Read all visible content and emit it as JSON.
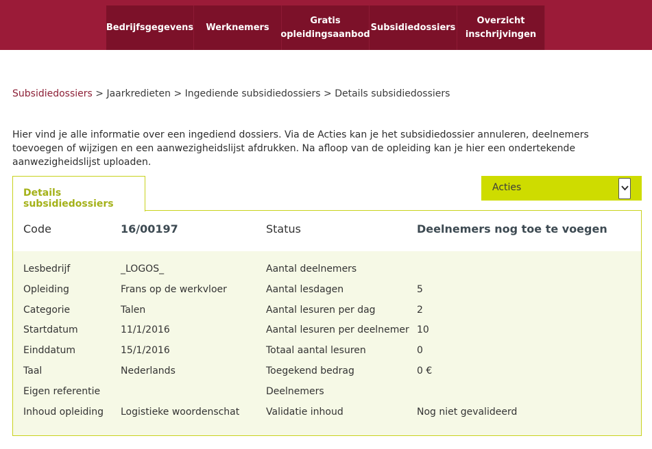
{
  "nav": {
    "items": [
      {
        "lines": [
          "Bedrijfsgegevens"
        ],
        "width": 128
      },
      {
        "lines": [
          "Werknemers"
        ],
        "width": 128
      },
      {
        "lines": [
          "Gratis",
          "opleidingsaanbod"
        ],
        "width": 128
      },
      {
        "lines": [
          "Subsidiedossiers"
        ],
        "width": 128
      },
      {
        "lines": [
          "Overzicht",
          "inschrijvingen"
        ],
        "width": 128
      }
    ]
  },
  "breadcrumb": {
    "link": "Subsidiedossiers",
    "rest": " > Jaarkredieten > Ingediende subsidiedossiers > Details subsidiedossiers"
  },
  "intro": "Hier vind je alle informatie over een ingediend dossiers. Via de Acties kan je het subsidiedossier annuleren, deelnemers toevoegen of wijzigen en een aanwezigheidslijst afdrukken. Na afloop van de opleiding kan je hier een ondertekende aanwezigheidslijst uploaden.",
  "tab": {
    "label": "Details subsidiedossiers"
  },
  "acties": {
    "label": "Acties",
    "color": "#cedc00"
  },
  "header": {
    "code_label": "Code",
    "code_value": "16/00197",
    "status_label": "Status",
    "status_value": "Deelnemers nog toe te voegen"
  },
  "rows": [
    {
      "l1": "Lesbedrijf",
      "v1": "_LOGOS_",
      "l2": "Aantal deelnemers",
      "v2": ""
    },
    {
      "l1": "Opleiding",
      "v1": "Frans op de werkvloer",
      "l2": "Aantal lesdagen",
      "v2": "5"
    },
    {
      "l1": "Categorie",
      "v1": "Talen",
      "l2": "Aantal lesuren per dag",
      "v2": "2"
    },
    {
      "l1": "Startdatum",
      "v1": "11/1/2016",
      "l2": "Aantal lesuren per deelnemer",
      "v2": "10"
    },
    {
      "l1": "Einddatum",
      "v1": "15/1/2016",
      "l2": "Totaal aantal lesuren",
      "v2": "0"
    },
    {
      "l1": "Taal",
      "v1": "Nederlands",
      "l2": "Toegekend bedrag",
      "v2": "0 €"
    },
    {
      "l1": "Eigen referentie",
      "v1": "",
      "l2": "Deelnemers",
      "v2": ""
    },
    {
      "l1": "Inhoud opleiding",
      "v1": "Logistieke woordenschat",
      "l2": "Validatie inhoud",
      "v2": "Nog niet gevalideerd"
    }
  ],
  "colors": {
    "brand": "#9b1b38",
    "nav_item": "#7c1129",
    "accent": "#cedc00",
    "panel_bg": "#f6f9e6"
  }
}
